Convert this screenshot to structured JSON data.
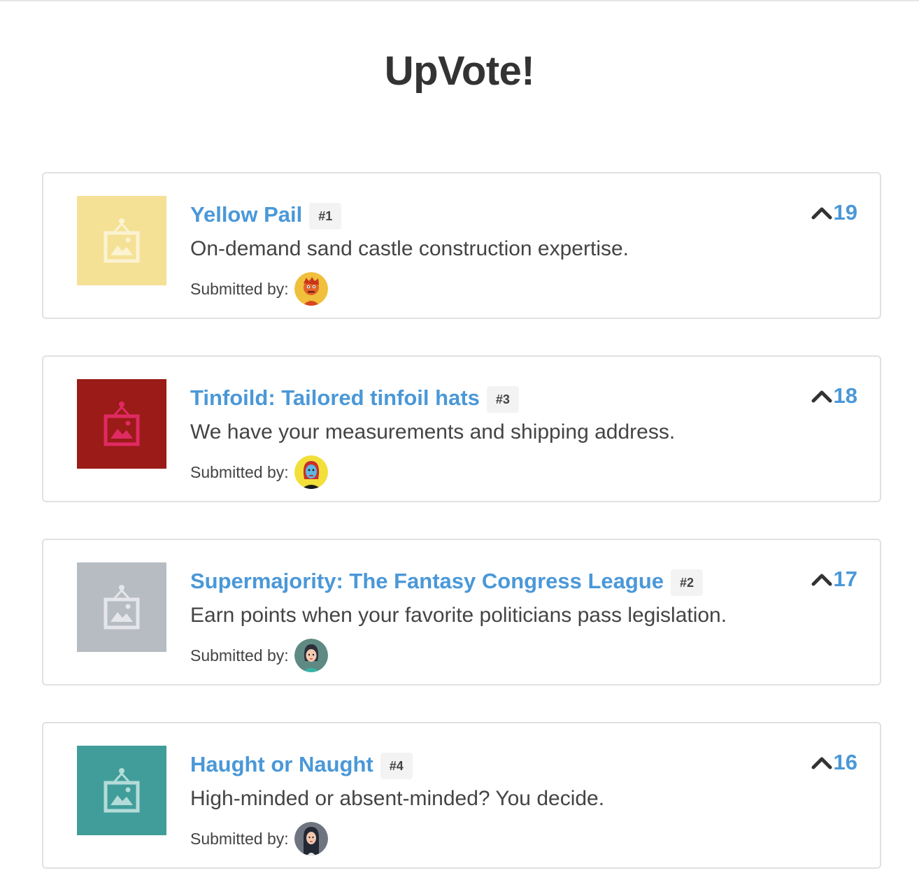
{
  "app": {
    "title": "UpVote!"
  },
  "submitted_label": "Submitted by:",
  "colors": {
    "link": "#4a98d8",
    "border": "#e1e1e4",
    "badge_bg": "#f3f3f3"
  },
  "products": [
    {
      "title": "Yellow Pail",
      "rank": "#1",
      "description": "On-demand sand castle construction expertise.",
      "votes": "19",
      "thumb_bg": "#f5e196",
      "thumb_icon_color": "#fbf3d2",
      "avatar_icon": "avatar-orange-character-icon"
    },
    {
      "title": "Tinfoild: Tailored tinfoil hats",
      "rank": "#3",
      "description": "We have your measurements and shipping address.",
      "votes": "18",
      "thumb_bg": "#9a1b17",
      "thumb_icon_color": "#e02a63",
      "avatar_icon": "avatar-red-hair-woman-icon"
    },
    {
      "title": "Supermajority: The Fantasy Congress League",
      "rank": "#2",
      "description": "Earn points when your favorite politicians pass legislation.",
      "votes": "17",
      "thumb_bg": "#b7bcc3",
      "thumb_icon_color": "#e4e6e9",
      "avatar_icon": "avatar-dark-hair-woman-icon"
    },
    {
      "title": "Haught or Naught",
      "rank": "#4",
      "description": "High-minded or absent-minded? You decide.",
      "votes": "16",
      "thumb_bg": "#419d99",
      "thumb_icon_color": "#b3dcd9",
      "avatar_icon": "avatar-long-hair-woman-icon"
    }
  ]
}
